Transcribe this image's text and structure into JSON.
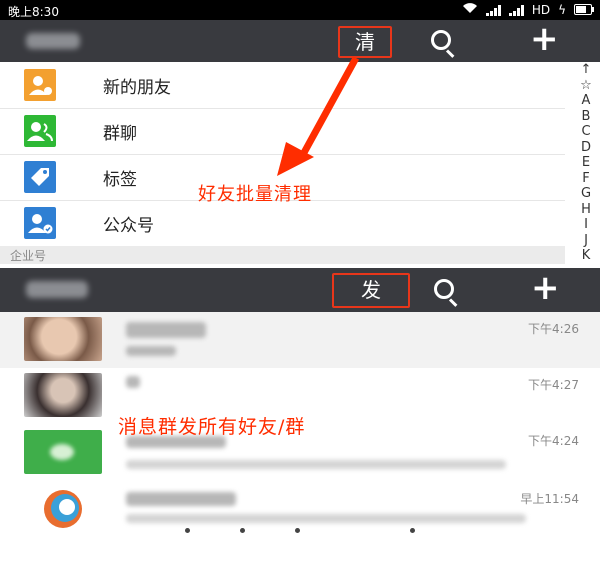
{
  "status_bar": {
    "time": "晚上8:30",
    "network": "HD"
  },
  "top_panel": {
    "highlight_button": "清",
    "contacts": [
      {
        "label": "新的朋友",
        "icon": "add-friend-icon",
        "color": "#f3a030"
      },
      {
        "label": "群聊",
        "icon": "group-chat-icon",
        "color": "#2eb835"
      },
      {
        "label": "标签",
        "icon": "tag-icon",
        "color": "#2f7fd3"
      },
      {
        "label": "公众号",
        "icon": "official-account-icon",
        "color": "#2f7fd3"
      }
    ],
    "section_header": "企业号",
    "alpha_index": [
      "↑",
      "☆",
      "A",
      "B",
      "C",
      "D",
      "E",
      "F",
      "G",
      "H",
      "I",
      "J",
      "K"
    ],
    "annotation": "好友批量清理"
  },
  "bottom_panel": {
    "highlight_button": "发",
    "chats": [
      {
        "time": "下午4:26",
        "avatar": "face-photo"
      },
      {
        "time": "下午4:27",
        "avatar": "person-photo"
      },
      {
        "time": "下午4:24",
        "avatar": "green-logo"
      },
      {
        "time": "早上11:54",
        "avatar": "round-logo"
      }
    ],
    "annotation": "消息群发所有好友/群"
  },
  "colors": {
    "bar": "#393a3f",
    "accent_red": "#e8361a",
    "annotation_red": "#ff2d00"
  }
}
